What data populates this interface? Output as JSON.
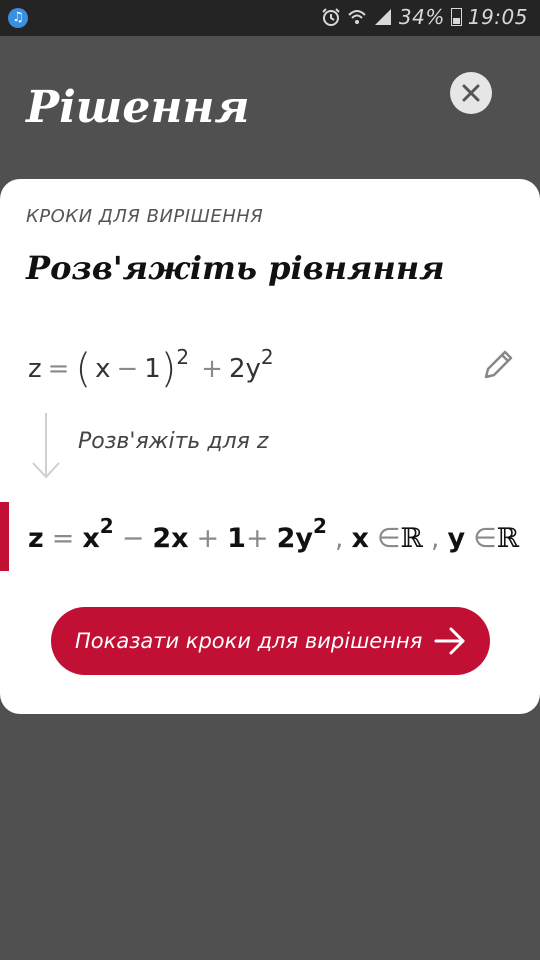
{
  "status_bar": {
    "battery_percent": "34%",
    "time": "19:05",
    "icons": [
      "music-notification-icon",
      "alarm-icon",
      "wifi-icon",
      "signal-icon",
      "battery-icon"
    ]
  },
  "header": {
    "title": "Рішення",
    "close_icon": "close-icon"
  },
  "card": {
    "label": "КРОКИ ДЛЯ ВИРІШЕННЯ",
    "title": "Розв'яжіть рівняння",
    "problem": {
      "lhs": "z",
      "eq": "=",
      "open_paren": "(",
      "x": "x",
      "minus": "−",
      "one": "1",
      "close_paren": ")",
      "exp1": "2",
      "plus": "+",
      "coef": "2",
      "y": "y",
      "exp2": "2"
    },
    "edit_icon": "pencil-icon",
    "step_text": "Розв'яжіть для z",
    "result": {
      "z": "z",
      "eq": "=",
      "x1": "x",
      "exp1": "2",
      "minus": "−",
      "two_x": "2x",
      "plus1": "+",
      "one": "1",
      "plus2": "+",
      "two_y": "2y",
      "exp2": "2",
      "comma1": ",",
      "x2": "x",
      "in1": "∈",
      "R1": "ℝ",
      "comma2": ",",
      "y": "y",
      "in2": "∈",
      "R2": "ℝ"
    },
    "button_label": "Показати кроки для вирішення",
    "accent_color": "#c21034"
  }
}
